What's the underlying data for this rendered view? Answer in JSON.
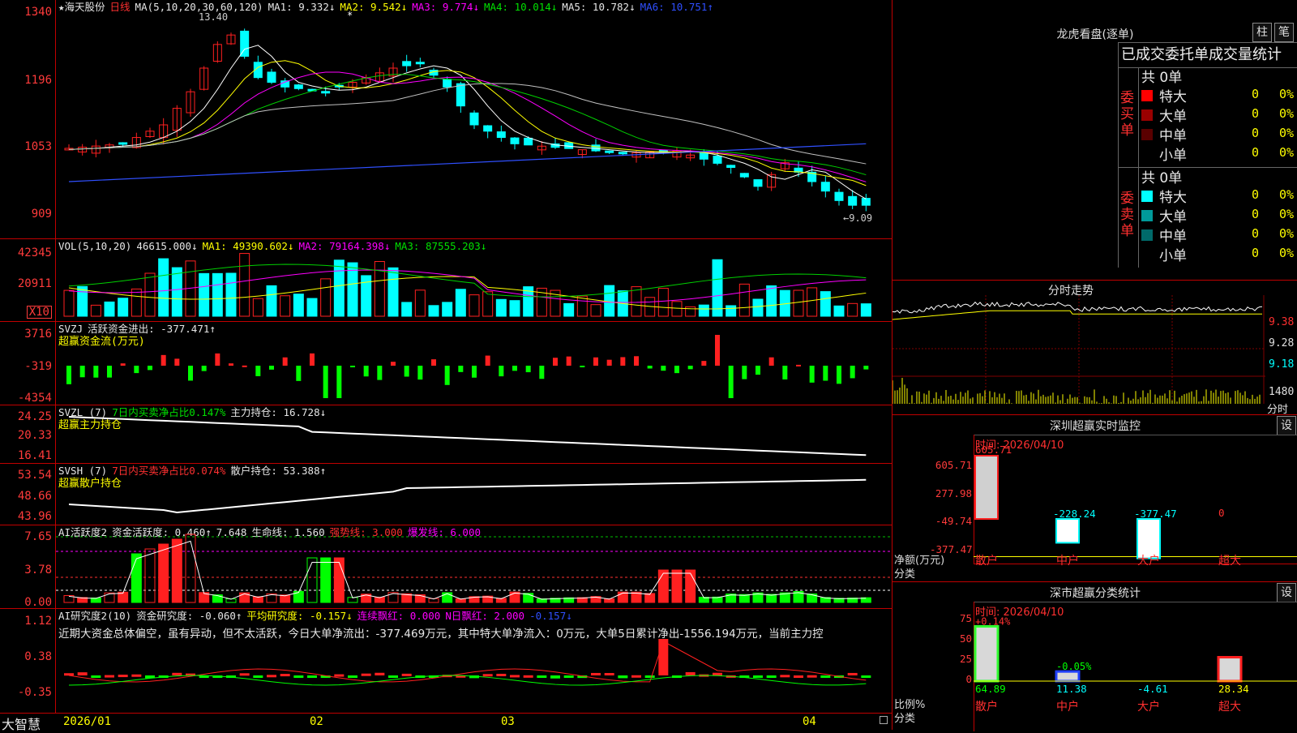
{
  "stock": {
    "name": "★海天股份",
    "period": "日线",
    "peak_label": "13.40",
    "low_label": "←9.09",
    "star": "*"
  },
  "price_pane": {
    "yticks": [
      "1340",
      "1196",
      "1053",
      "909"
    ],
    "ma_header": {
      "ma": "MA(5,10,20,30,60,120)",
      "ma1": "MA1: 9.332↓",
      "ma2": "MA2: 9.542↓",
      "ma3": "MA3: 9.774↓",
      "ma4": "MA4: 10.014↓",
      "ma5": "MA5: 10.782↓",
      "ma6": "MA6: 10.751↑"
    },
    "colors": {
      "up": "#ff2020",
      "down": "#00ffff",
      "ma1": "#ffffff",
      "ma2": "#ffff00",
      "ma3": "#ff00ff",
      "ma4": "#00d000",
      "ma5": "#c0c0c0",
      "ma6": "#3050ff"
    }
  },
  "vol_pane": {
    "header": {
      "a": "VOL(5,10,20)",
      "b": "46615.000↓",
      "c": "MA1: 49390.602↓",
      "d": "MA2: 79164.398↓",
      "e": "MA3: 87555.203↓"
    },
    "yticks": [
      "42345",
      "20911"
    ],
    "unit": "X10"
  },
  "svzj_pane": {
    "header": {
      "a": "SVZJ",
      "b": "活跃资金进出: -377.471↑",
      "c": "超赢资金流(万元)"
    },
    "yticks": [
      "3716",
      "-319",
      "-4354"
    ]
  },
  "svzl_pane": {
    "header": {
      "a": "SVZL (7)",
      "b": "7日内买卖净占比0.147%",
      "c": "主力持仓: 16.728↓",
      "d": "超赢主力持仓"
    },
    "yticks": [
      "24.25",
      "20.33",
      "16.41"
    ]
  },
  "svsh_pane": {
    "header": {
      "a": "SVSH (7)",
      "b": "7日内买卖净占比0.074%",
      "c": "散户持仓: 53.388↑",
      "d": "超赢散户持仓"
    },
    "yticks": [
      "53.54",
      "48.66",
      "43.96"
    ]
  },
  "ai_pane": {
    "header": {
      "a": "AI活跃度2",
      "b": "资金活跃度: 0.460↑",
      "c": "7.648",
      "d": "生命线: 1.560",
      "e": "强势线: 3.000",
      "f": "爆发线: 6.000"
    },
    "yticks": [
      "7.65",
      "3.78",
      "0.00"
    ]
  },
  "research_pane": {
    "header": {
      "a": "AI研究度2(10)",
      "b": "资金研究度: -0.060↑",
      "c": "平均研究度: -0.157↓",
      "d": "连续飘红: 0.000",
      "e": "N日飘红: 2.000",
      "f": "-0.157↓"
    },
    "comment": "近期大资金总体偏空，虽有异动，但不太活跃，今日大单净流出：-377.469万元，其中特大单净流入：0万元，大单5日累计净出-1556.194万元，当前主力控",
    "yticks": [
      "1.12",
      "0.38",
      "-0.35"
    ]
  },
  "xaxis": {
    "brand": "大智慧",
    "labels": [
      "2026/01",
      "02",
      "03",
      "04"
    ]
  },
  "dragon": {
    "title": "龙虎看盘(逐单)",
    "btn1": "柱",
    "btn2": "笔",
    "subtitle": "已成交委托单成交量统计",
    "buy": {
      "label": "委买单",
      "total": "共 0单",
      "rows": [
        {
          "name": "特大",
          "v": "0",
          "p": "0%",
          "c": "#ff0000"
        },
        {
          "name": "大单",
          "v": "0",
          "p": "0%",
          "c": "#9a0000"
        },
        {
          "name": "中单",
          "v": "0",
          "p": "0%",
          "c": "#5a0000"
        },
        {
          "name": "小单",
          "v": "0",
          "p": "0%",
          "c": ""
        }
      ]
    },
    "sell": {
      "label": "委卖单",
      "total": "共 0单",
      "rows": [
        {
          "name": "特大",
          "v": "0",
          "p": "0%",
          "c": "#00ffff"
        },
        {
          "name": "大单",
          "v": "0",
          "p": "0%",
          "c": "#009a9a"
        },
        {
          "name": "中单",
          "v": "0",
          "p": "0%",
          "c": "#006a6a"
        },
        {
          "name": "小单",
          "v": "0",
          "p": "0%",
          "c": ""
        }
      ]
    }
  },
  "intraday": {
    "title": "分时走势",
    "yticks": [
      "9.38",
      "9.28",
      "9.18"
    ],
    "vol_tick": "1480",
    "unit": "分时"
  },
  "sz_monitor": {
    "title": "深圳超赢实时监控",
    "btn": "设",
    "time": "时间: 2026/04/10",
    "yticks": [
      "605.71",
      "277.98",
      "-49.74",
      "-377.47"
    ],
    "net_label": "净额(万元)",
    "cat_label": "分类",
    "bars": [
      {
        "cat": "散户",
        "value": 605.71,
        "label": "605.71"
      },
      {
        "cat": "中户",
        "value": -228.24,
        "label": "-228.24"
      },
      {
        "cat": "大户",
        "value": -377.47,
        "label": "-377.47"
      },
      {
        "cat": "超大",
        "value": 0,
        "label": "0"
      }
    ]
  },
  "sz_class": {
    "title": "深市超赢分类统计",
    "btn": "设",
    "time": "时间: 2026/04/10",
    "yticks": [
      "75",
      "50",
      "25",
      "0"
    ],
    "ratio_label": "比例%",
    "cat_label": "分类",
    "bars": [
      {
        "cat": "散户",
        "value": 64.89,
        "label": "64.89",
        "top": "+0.14%"
      },
      {
        "cat": "中户",
        "value": 11.38,
        "label": "11.38",
        "top": "-0.05%"
      },
      {
        "cat": "大户",
        "value": -4.61,
        "label": "-4.61",
        "top": ""
      },
      {
        "cat": "超大",
        "value": 28.34,
        "label": "28.34",
        "top": ""
      }
    ]
  }
}
